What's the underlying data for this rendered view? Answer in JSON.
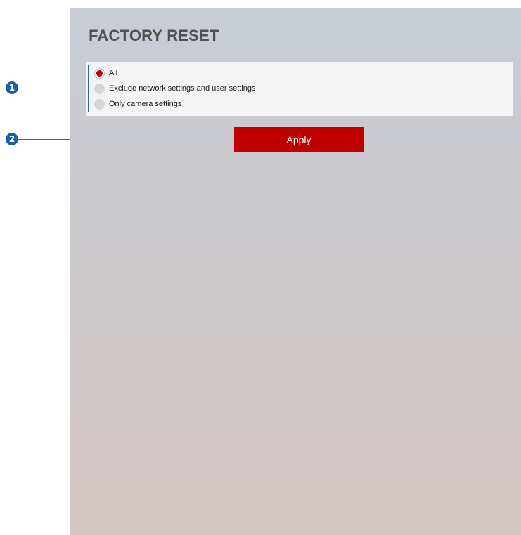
{
  "panel": {
    "title": "FACTORY RESET"
  },
  "reset_options": {
    "selected": "All",
    "items": [
      {
        "label": "All",
        "checked": true
      },
      {
        "label": "Exclude network settings and user settings",
        "checked": false
      },
      {
        "label": "Only camera settings",
        "checked": false
      }
    ]
  },
  "apply_button": {
    "label": "Apply"
  },
  "callouts": [
    {
      "number": "1"
    },
    {
      "number": "2"
    }
  ],
  "colors": {
    "accent_red": "#c00000",
    "callout_blue": "#1b5fa6",
    "title_gray": "#505050"
  }
}
